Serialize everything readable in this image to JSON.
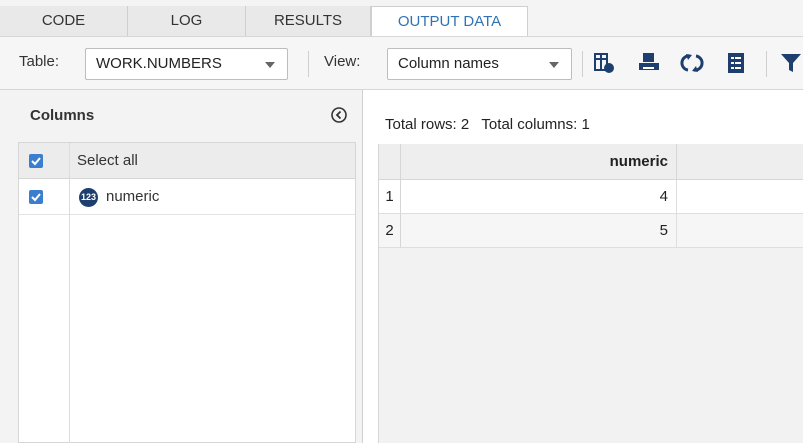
{
  "tabs": [
    {
      "label": "CODE",
      "active": false
    },
    {
      "label": "LOG",
      "active": false
    },
    {
      "label": "RESULTS",
      "active": false
    },
    {
      "label": "OUTPUT DATA",
      "active": true
    }
  ],
  "toolbar": {
    "table_label": "Table:",
    "table_value": "WORK.NUMBERS",
    "view_label": "View:",
    "view_value": "Column names",
    "icons": [
      "column-properties-icon",
      "print-icon",
      "refresh-icon",
      "table-properties-icon",
      "filter-icon"
    ]
  },
  "columns_panel": {
    "title": "Columns",
    "select_all_label": "Select all",
    "items": [
      {
        "type_badge": "123",
        "name": "numeric",
        "checked": true
      }
    ]
  },
  "data_panel": {
    "summary": "Total rows: 2   Total columns: 1",
    "column_header": "numeric",
    "rows": [
      {
        "num": "1",
        "value": "4"
      },
      {
        "num": "2",
        "value": "5"
      }
    ]
  },
  "colors": {
    "accent": "#2f73b6",
    "checkbox": "#3a7fcf",
    "badge": "#1e3f6d"
  }
}
